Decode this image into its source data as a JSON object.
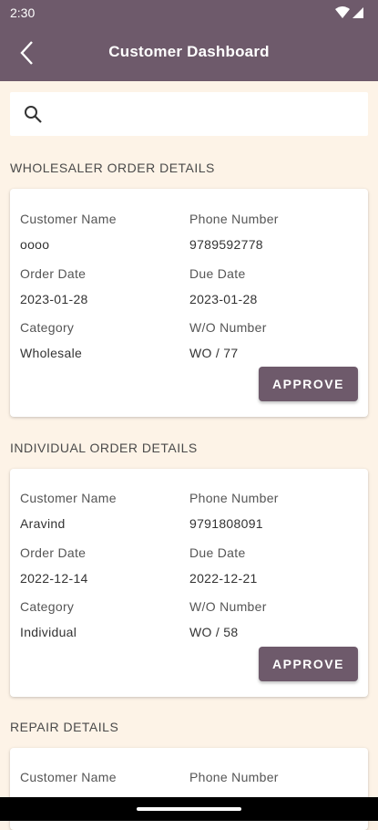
{
  "status_bar": {
    "time": "2:30"
  },
  "app_bar": {
    "title": "Customer Dashboard"
  },
  "search": {
    "value": "",
    "placeholder": ""
  },
  "sections": [
    {
      "title": "WHOLESALER ORDER DETAILS",
      "customer_name_label": "Customer Name",
      "customer_name": "oooo",
      "phone_label": "Phone Number",
      "phone": "9789592778",
      "order_date_label": "Order Date",
      "order_date": "2023-01-28",
      "due_date_label": "Due Date",
      "due_date": "2023-01-28",
      "category_label": "Category",
      "category": "Wholesale",
      "wo_label": "W/O Number",
      "wo_number": "WO / 77",
      "button": "APPROVE"
    },
    {
      "title": "INDIVIDUAL ORDER DETAILS",
      "customer_name_label": "Customer Name",
      "customer_name": "Aravind",
      "phone_label": "Phone Number",
      "phone": "9791808091",
      "order_date_label": "Order Date",
      "order_date": "2022-12-14",
      "due_date_label": "Due Date",
      "due_date": "2022-12-21",
      "category_label": "Category",
      "category": "Individual",
      "wo_label": "W/O Number",
      "wo_number": "WO / 58",
      "button": "APPROVE"
    },
    {
      "title": "REPAIR DETAILS",
      "customer_name_label": "Customer Name",
      "phone_label": "Phone Number"
    }
  ],
  "colors": {
    "primary": "#6e5a6b",
    "background": "#fdf3e7",
    "card": "#ffffff"
  }
}
